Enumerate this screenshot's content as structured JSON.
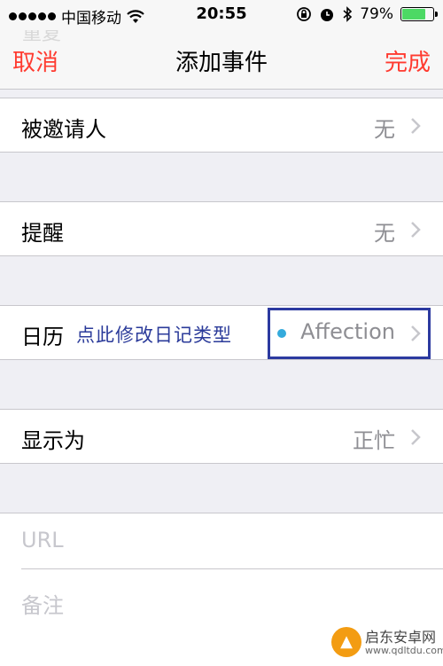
{
  "status_bar": {
    "carrier": "中国移动",
    "time": "20:55",
    "battery_percent": "79%",
    "battery_level": 0.79,
    "icons": [
      "signal-dots",
      "wifi-icon",
      "orientation-lock-icon",
      "alarm-icon",
      "bluetooth-icon",
      "battery-icon"
    ]
  },
  "navbar": {
    "cancel": "取消",
    "title": "添加事件",
    "done": "完成",
    "accent_color": "#ff3b30"
  },
  "rows": {
    "invitees": {
      "label": "被邀请人",
      "value": "无"
    },
    "alert": {
      "label": "提醒",
      "value": "无"
    },
    "calendar": {
      "label": "日历",
      "value": "Affection",
      "dot_color": "#34aadc",
      "annotation": "点此修改日记类型"
    },
    "show_as": {
      "label": "显示为",
      "value": "正忙"
    }
  },
  "notes": {
    "url_placeholder": "URL",
    "notes_placeholder": "备注"
  },
  "watermark": {
    "name": "启东安卓网",
    "url": "www.qdltdu.com"
  }
}
